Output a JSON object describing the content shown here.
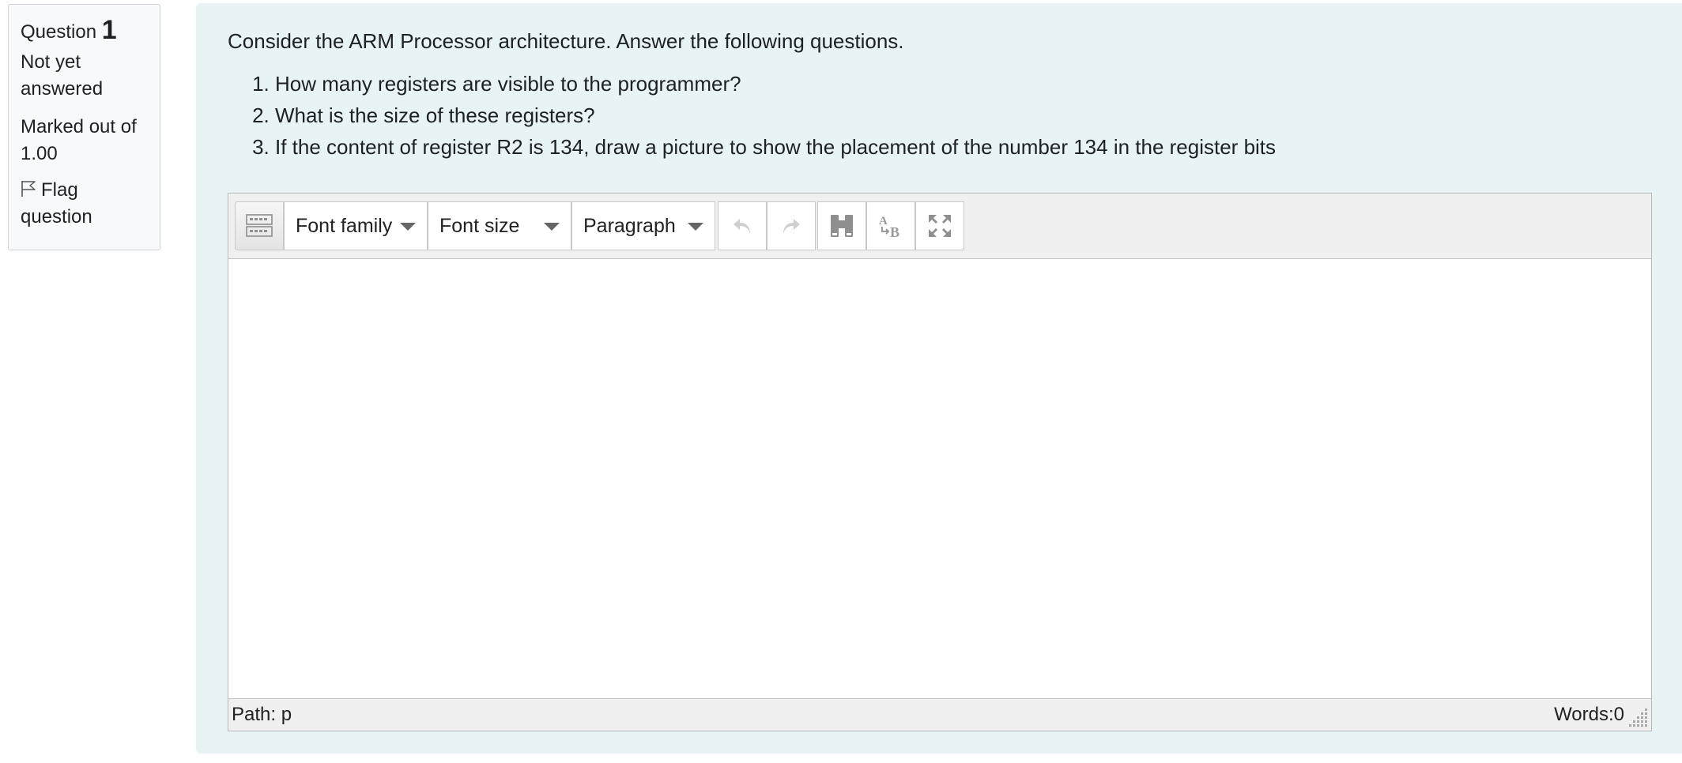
{
  "question_info": {
    "question_label": "Question",
    "question_number": "1",
    "state": "Not yet answered",
    "grade": "Marked out of 1.00",
    "flag_label": "Flag question"
  },
  "question": {
    "intro": "Consider the ARM Processor architecture. Answer the following questions.",
    "items": [
      "How many registers are visible to the programmer?",
      "What is the size of these registers?",
      "If the content of register R2 is 134, draw a picture to show the placement of the number 134 in the register bits"
    ]
  },
  "editor": {
    "toolbar": {
      "font_family": "Font family",
      "font_size": "Font size",
      "format": "Paragraph",
      "icons": [
        "toolbar-toggle-icon",
        "undo-icon",
        "redo-icon",
        "find-icon",
        "spellcheck-icon",
        "fullscreen-icon"
      ]
    },
    "status": {
      "path": "Path: p",
      "words": "Words:0"
    }
  },
  "colors": {
    "content_bg": "#e7f3f5",
    "info_bg": "#f8f9fa",
    "toolbar_bg": "#f0f0f0",
    "disabled_icon": "#bdbdbd",
    "icon": "#8f8f8f"
  }
}
